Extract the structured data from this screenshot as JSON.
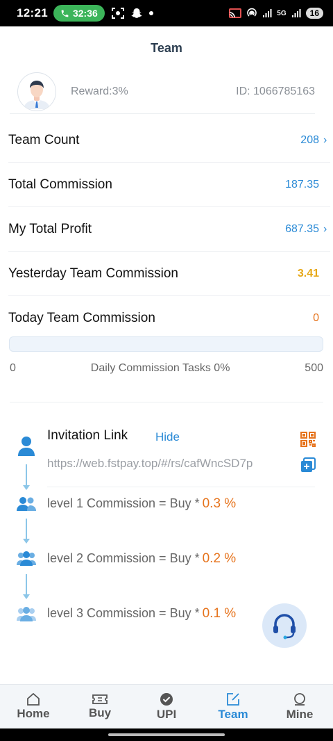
{
  "status_bar": {
    "time": "12:21",
    "call_duration": "32:36",
    "battery": "16",
    "network": "5G"
  },
  "header": {
    "title": "Team"
  },
  "profile": {
    "reward": "Reward:3%",
    "id": "ID: 1066785163"
  },
  "stats": [
    {
      "label": "Team Count",
      "value": "208",
      "has_chevron": true
    },
    {
      "label": "Total Commission",
      "value": "187.35",
      "has_chevron": false
    },
    {
      "label": "My Total Profit",
      "value": "687.35",
      "has_chevron": true
    },
    {
      "label": "Yesterday Team Commission",
      "value": "3.41",
      "has_chevron": false
    },
    {
      "label": "Today Team Commission",
      "value": "0",
      "has_chevron": false
    }
  ],
  "tasks": {
    "min": "0",
    "label": "Daily Commission Tasks 0%",
    "max": "500",
    "progress_fraction": 0
  },
  "invitation": {
    "title": "Invitation Link",
    "hide_label": "Hide",
    "link": "https://web.fstpay.top/#/rs/cafWncSD7p"
  },
  "levels": [
    {
      "text": "level 1 Commission = Buy *",
      "rate": "0.3 %"
    },
    {
      "text": "level 2 Commission = Buy *",
      "rate": "0.2 %"
    },
    {
      "text": "level 3 Commission = Buy *",
      "rate": "0.1 %"
    }
  ],
  "nav": [
    {
      "label": "Home",
      "icon": "home-icon"
    },
    {
      "label": "Buy",
      "icon": "ticket-icon"
    },
    {
      "label": "UPI",
      "icon": "check-circle-icon"
    },
    {
      "label": "Team",
      "icon": "edit-icon",
      "active": true
    },
    {
      "label": "Mine",
      "icon": "user-icon"
    }
  ],
  "colors": {
    "accent": "#2a8ad6",
    "orange": "#e6731c",
    "gold": "#e6a817"
  }
}
